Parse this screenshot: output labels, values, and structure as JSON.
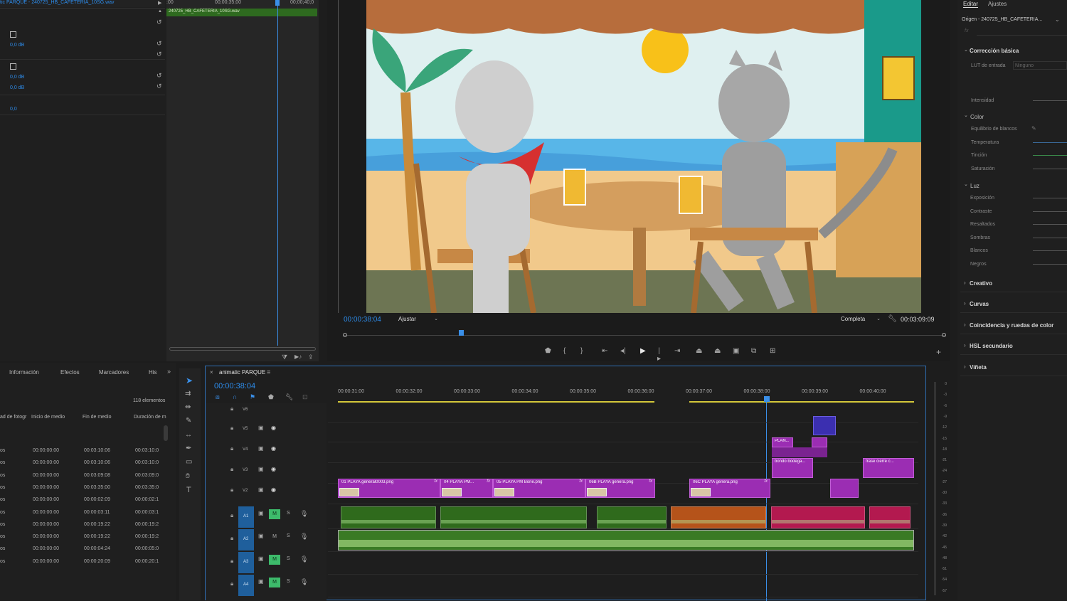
{
  "source_panel": {
    "title": "tic PARQUE - 240725_HB_CAFETERIA_10SG.wav",
    "rows": [
      "0,0 dB",
      "0,0 dB",
      "0,0 dB",
      "0,0"
    ],
    "time_left": ":00",
    "time_mid": "00;00;35;00",
    "time_right": "00;00;40;0",
    "clip_label": "240725_HB_CAFETERIA_10SG.wav"
  },
  "program": {
    "timecode": "00:00:38:04",
    "fit": "Ajustar",
    "quality": "Completa",
    "duration": "00:03:09:09"
  },
  "project": {
    "tabs": [
      "Información",
      "Efectos",
      "Marcadores",
      "His"
    ],
    "count": "118 elementos",
    "cols": [
      "ad de fotogr",
      "Inicio de medio",
      "Fin de medio",
      "Duración de m"
    ],
    "rows": [
      [
        "os",
        "00:00:00:00",
        "00:03:10:06",
        "00:03:10:0"
      ],
      [
        "os",
        "00:00:00:00",
        "00:03:10:06",
        "00:03:10:0"
      ],
      [
        "os",
        "00:00:00:00",
        "00:03:09:08",
        "00:03:09:0"
      ],
      [
        "os",
        "00:00:00:00",
        "00:03:35:00",
        "00:03:35:0"
      ],
      [
        "os",
        "00:00:00:00",
        "00:00:02:09",
        "00:00:02:1"
      ],
      [
        "os",
        "00:00:00:00",
        "00:00:03:11",
        "00:00:03:1"
      ],
      [
        "os",
        "00:00:00:00",
        "00:00:19:22",
        "00:00:19:2"
      ],
      [
        "os",
        "00:00:00:00",
        "00:00:19:22",
        "00:00:19:2"
      ],
      [
        "os",
        "00:00:00:00",
        "00:00:04:24",
        "00:00:05:0"
      ],
      [
        "os",
        "00:00:00:00",
        "00:00:20:09",
        "00:00:20:1"
      ]
    ]
  },
  "timeline": {
    "tab": "animatic PARQUE",
    "timecode": "00:00:38:04",
    "ruler": [
      "00:00:31:00",
      "00:00:32:00",
      "00:00:33:00",
      "00:00:34:00",
      "00:00:35:00",
      "00:00:36:00",
      "00:00:37:00",
      "00:00:38:00",
      "00:00:39:00",
      "00:00:40:00"
    ],
    "video_tracks": [
      "V6",
      "V5",
      "V4",
      "V3",
      "V2"
    ],
    "audio_tracks": [
      "A1",
      "A2",
      "A3",
      "A4"
    ],
    "m_label": "M",
    "s_label": "S",
    "clips": [
      "01 PLAYA general0003.png",
      "04 PLAYA PM...",
      "05 PLAYA PM Bone.png",
      "06B PLAYA genera.png",
      "06C PLAYA genera.png",
      "PLAN...",
      "bondo bodega...",
      "frase cierre c..."
    ],
    "fx": "fx",
    "meter": [
      "0",
      "-3",
      "-6",
      "-9",
      "-12",
      "-15",
      "-18",
      "-21",
      "-24",
      "-27",
      "-30",
      "-33",
      "-36",
      "-39",
      "-42",
      "-45",
      "-48",
      "-51",
      "-54",
      "-57"
    ]
  },
  "lumetri": {
    "tabs": [
      "Editar",
      "Ajustes"
    ],
    "source": "Origen - 240725_HB_CAFETERIA...",
    "fx": "fx",
    "basic": "Corrección básica",
    "lut_label": "LUT de entrada",
    "lut_value": "Ninguno",
    "intensity": "Intensidad",
    "color": "Color",
    "color_items": [
      "Equilibrio de blancos",
      "Temperatura",
      "Tinción",
      "Saturación"
    ],
    "light": "Luz",
    "light_items": [
      "Exposición",
      "Contraste",
      "Resaltados",
      "Sombras",
      "Blancos",
      "Negros"
    ],
    "sections": [
      "Creativo",
      "Curvas",
      "Coincidencia y ruedas de color",
      "HSL secundario",
      "Viñeta"
    ]
  }
}
